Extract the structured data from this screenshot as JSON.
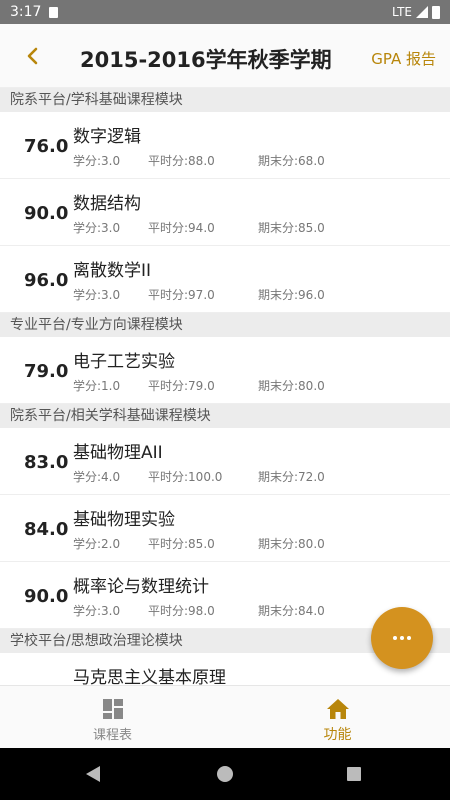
{
  "status": {
    "time": "3:17",
    "network": "LTE"
  },
  "header": {
    "title": "2015-2016学年秋季学期",
    "gpa_label": "GPA 报告"
  },
  "sections": [
    {
      "title": "院系平台/学科基础课程模块",
      "courses": [
        {
          "score": "76.0",
          "name": "数字逻辑",
          "credit": "学分:3.0",
          "usual": "平时分:88.0",
          "final": "期末分:68.0"
        },
        {
          "score": "90.0",
          "name": "数据结构",
          "credit": "学分:3.0",
          "usual": "平时分:94.0",
          "final": "期末分:85.0"
        },
        {
          "score": "96.0",
          "name": "离散数学II",
          "credit": "学分:3.0",
          "usual": "平时分:97.0",
          "final": "期末分:96.0"
        }
      ]
    },
    {
      "title": "专业平台/专业方向课程模块",
      "courses": [
        {
          "score": "79.0",
          "name": "电子工艺实验",
          "credit": "学分:1.0",
          "usual": "平时分:79.0",
          "final": "期末分:80.0"
        }
      ]
    },
    {
      "title": "院系平台/相关学科基础课程模块",
      "courses": [
        {
          "score": "83.0",
          "name": "基础物理AII",
          "credit": "学分:4.0",
          "usual": "平时分:100.0",
          "final": "期末分:72.0"
        },
        {
          "score": "84.0",
          "name": "基础物理实验",
          "credit": "学分:2.0",
          "usual": "平时分:85.0",
          "final": "期末分:80.0"
        },
        {
          "score": "90.0",
          "name": "概率论与数理统计",
          "credit": "学分:3.0",
          "usual": "平时分:98.0",
          "final": "期末分:84.0"
        }
      ]
    },
    {
      "title": "学校平台/思想政治理论模块",
      "courses": [
        {
          "score": "",
          "name": "马克思主义基本原理",
          "credit": "",
          "usual": "",
          "final": ""
        }
      ]
    }
  ],
  "bottom_nav": {
    "schedule_label": "课程表",
    "functions_label": "功能"
  },
  "colors": {
    "accent": "#b8860b",
    "fab": "#d4921f"
  }
}
